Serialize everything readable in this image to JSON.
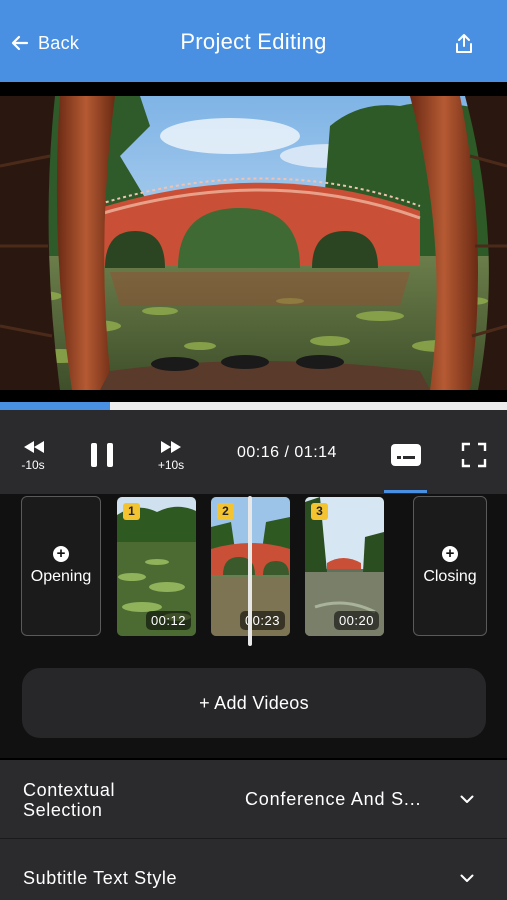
{
  "header": {
    "back_label": "Back",
    "title": "Project Editing",
    "accent_color": "#4A90E2"
  },
  "player": {
    "progress_fraction": 0.216,
    "rewind_label": "-10s",
    "forward_label": "+10s",
    "current_time": "00:16",
    "total_time": "01:14",
    "time_separator": " / "
  },
  "timeline": {
    "opening_label": "Opening",
    "closing_label": "Closing",
    "clips": [
      {
        "index": "1",
        "duration": "00:12"
      },
      {
        "index": "2",
        "duration": "00:23"
      },
      {
        "index": "3",
        "duration": "00:20"
      }
    ],
    "add_videos_label": "+ Add Videos"
  },
  "settings": {
    "contextual_selection_label": "Contextual Selection",
    "contextual_selection_value": "Conference And S...",
    "subtitle_style_label": "Subtitle Text Style"
  },
  "icons": [
    "back-arrow-icon",
    "share-icon",
    "rewind-10-icon",
    "pause-icon",
    "forward-10-icon",
    "subtitles-icon",
    "fullscreen-icon",
    "add-circle-icon",
    "chevron-down-icon"
  ]
}
